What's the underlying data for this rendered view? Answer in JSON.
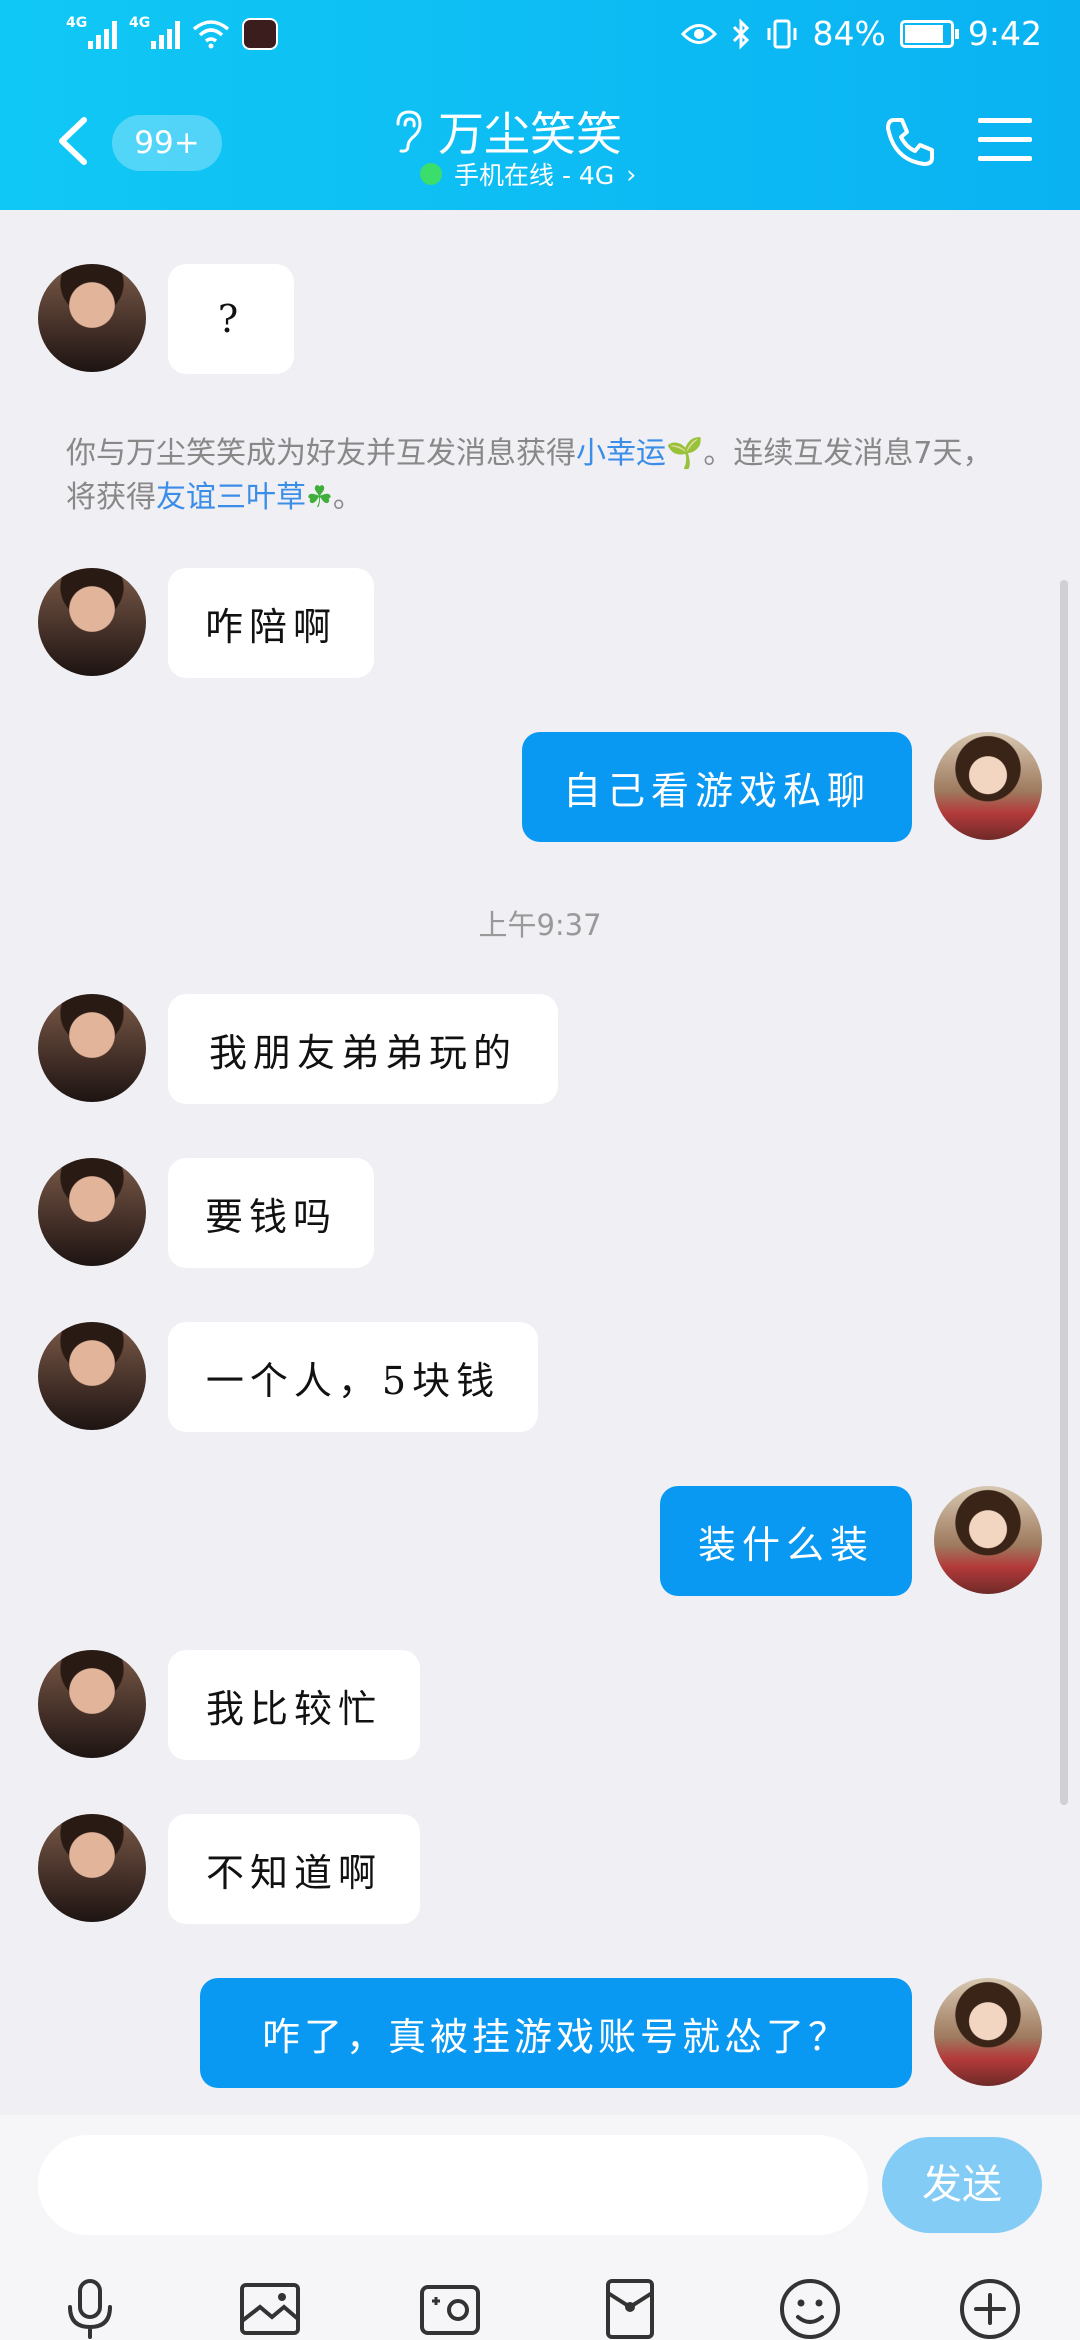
{
  "status_bar": {
    "network_1": "4G",
    "network_2": "4G",
    "battery_percent": "84%",
    "time": "9:42"
  },
  "header": {
    "unread_badge": "99+",
    "contact_name": "万尘笑笑",
    "online_status": "手机在线 - 4G",
    "chevron": "›"
  },
  "messages": [
    {
      "side": "in",
      "text": "?"
    },
    {
      "side": "in",
      "text": "咋陪啊"
    },
    {
      "side": "out",
      "text": "自己看游戏私聊"
    },
    {
      "side": "in",
      "text": "我朋友弟弟玩的"
    },
    {
      "side": "in",
      "text": "要钱吗"
    },
    {
      "side": "in",
      "text": "一个人，5块钱"
    },
    {
      "side": "out",
      "text": "装什么装"
    },
    {
      "side": "in",
      "text": "我比较忙"
    },
    {
      "side": "in",
      "text": "不知道啊"
    },
    {
      "side": "out",
      "text": "咋了，真被挂游戏账号就怂了？"
    }
  ],
  "system_notice": {
    "part1": "你与万尘笑笑成为好友并互发消息获得",
    "link1": "小幸运",
    "sprout_icon": "🌱",
    "part2": "。连续互发消息7天，将获得",
    "link2": "友谊三叶草",
    "clover_icon": "☘",
    "part3": "。"
  },
  "timestamp": "上午9:37",
  "input_bar": {
    "send_label": "发送",
    "tools": [
      "microphone-icon",
      "image-icon",
      "camera-icon",
      "red-packet-icon",
      "emoji-icon",
      "plus-icon"
    ]
  },
  "colors": {
    "header": "#0ab2f2",
    "out_bubble": "#0a99f2",
    "send_button": "#83ccf6",
    "link": "#3b8ee8"
  }
}
